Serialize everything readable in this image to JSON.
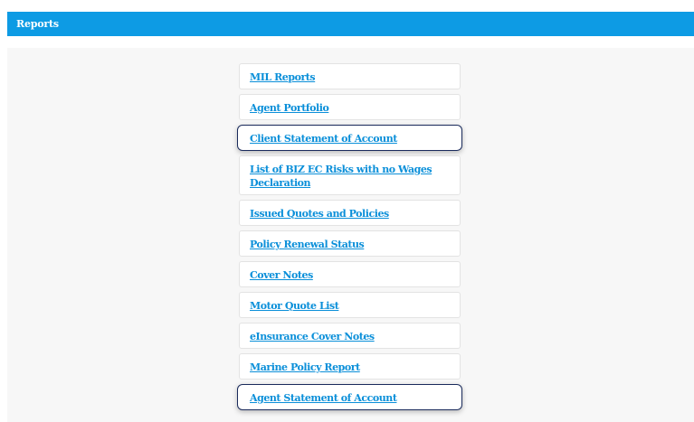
{
  "header": {
    "title": "Reports"
  },
  "colors": {
    "header_bg": "#0d9be4",
    "link": "#0a8fd9",
    "panel_bg": "#f7f7f7",
    "highlight_border": "#1a2b5c"
  },
  "reports": {
    "items": [
      {
        "label": "MIL Reports",
        "selected": false
      },
      {
        "label": "Agent Portfolio",
        "selected": false
      },
      {
        "label": "Client Statement of Account",
        "selected": true
      },
      {
        "label": "List of BIZ EC Risks with no Wages Declaration",
        "selected": false
      },
      {
        "label": "Issued Quotes and Policies",
        "selected": false
      },
      {
        "label": "Policy Renewal Status",
        "selected": false
      },
      {
        "label": "Cover Notes",
        "selected": false
      },
      {
        "label": "Motor Quote List",
        "selected": false
      },
      {
        "label": "eInsurance Cover Notes",
        "selected": false
      },
      {
        "label": "Marine Policy Report",
        "selected": false
      },
      {
        "label": "Agent Statement of Account",
        "selected": true
      }
    ]
  }
}
